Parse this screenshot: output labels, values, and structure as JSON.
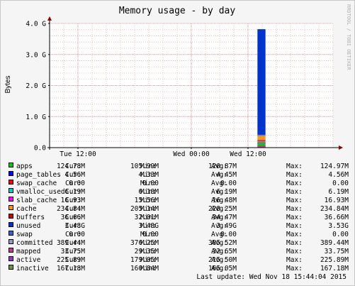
{
  "chart_data": {
    "type": "area",
    "title": "Memory usage - by day",
    "ylabel": "Bytes",
    "xlabel": "",
    "watermark": "RRDTOOL / TOBI OETIKER",
    "ylim": [
      0,
      4.0
    ],
    "y_unit": "G",
    "y_ticks": [
      "0.0",
      "1.0 G",
      "2.0 G",
      "3.0 G",
      "4.0 G"
    ],
    "y_tick_values": [
      0,
      1,
      2,
      3,
      4
    ],
    "x_ticks": [
      "Tue 12:00",
      "Wed 00:00",
      "Wed 12:00"
    ],
    "x_range_hours": [
      -30,
      30
    ],
    "x_tick_hours": [
      -24,
      0,
      12
    ],
    "data_start_hour": 14,
    "data_end_hour": 15.7,
    "grid": true,
    "series": [
      {
        "name": "apps",
        "color": "#00cc00",
        "gb": 0.122
      },
      {
        "name": "page_tables",
        "color": "#0000ff",
        "gb": 0.0045
      },
      {
        "name": "swap_cache",
        "color": "#ff0000",
        "gb": 0.0
      },
      {
        "name": "vmalloc_used",
        "color": "#00cccc",
        "gb": 0.006
      },
      {
        "name": "slab_cache",
        "color": "#ff00ff",
        "gb": 0.0165
      },
      {
        "name": "cache",
        "color": "#ff9900",
        "gb": 0.229
      },
      {
        "name": "buffers",
        "color": "#cc0000",
        "gb": 0.036
      },
      {
        "name": "unused",
        "color": "#0033cc",
        "gb": 3.4
      },
      {
        "name": "swap",
        "color": "#3366cc",
        "gb": 0.0
      },
      {
        "name": "committed",
        "color": "#9999cc",
        "gb": 0.38
      },
      {
        "name": "mapped",
        "color": "#cc3399",
        "gb": 0.033
      },
      {
        "name": "active",
        "color": "#9933cc",
        "gb": 0.221
      },
      {
        "name": "inactive",
        "color": "#669933",
        "gb": 0.163
      }
    ]
  },
  "legend": {
    "cur_label": "Cur:",
    "min_label": "Min:",
    "avg_label": "Avg:",
    "max_label": "Max:",
    "rows": [
      {
        "name": "apps",
        "color": "#00cc00",
        "cur": "124.78M",
        "min": "105.99M",
        "avg": "120.87M",
        "max": "124.97M"
      },
      {
        "name": "page_tables",
        "color": "#0000ff",
        "cur": "4.56M",
        "min": "4.33M",
        "avg": "4.45M",
        "max": "4.56M"
      },
      {
        "name": "swap_cache",
        "color": "#ff0000",
        "cur": "0.00",
        "min": "0.00",
        "avg": "0.00",
        "max": "0.00"
      },
      {
        "name": "vmalloc_used",
        "color": "#00cccc",
        "cur": "6.19M",
        "min": "6.18M",
        "avg": "6.19M",
        "max": "6.19M"
      },
      {
        "name": "slab_cache",
        "color": "#ff00ff",
        "cur": "16.93M",
        "min": "15.56M",
        "avg": "16.48M",
        "max": "16.93M"
      },
      {
        "name": "cache",
        "color": "#ff9900",
        "cur": "234.84M",
        "min": "205.14M",
        "avg": "228.25M",
        "max": "234.84M"
      },
      {
        "name": "buffers",
        "color": "#cc0000",
        "cur": "36.66M",
        "min": "32.01M",
        "avg": "34.47M",
        "max": "36.66M"
      },
      {
        "name": "unused",
        "color": "#0033cc",
        "cur": "3.48G",
        "min": "3.48G",
        "avg": "3.49G",
        "max": "3.53G"
      },
      {
        "name": "swap",
        "color": "#3366cc",
        "cur": "0.00",
        "min": "0.00",
        "avg": "0.00",
        "max": "0.00"
      },
      {
        "name": "committed",
        "color": "#9999cc",
        "cur": "389.44M",
        "min": "376.25M",
        "avg": "385.52M",
        "max": "389.44M"
      },
      {
        "name": "mapped",
        "color": "#cc3399",
        "cur": "33.75M",
        "min": "29.35M",
        "avg": "32.65M",
        "max": "33.75M"
      },
      {
        "name": "active",
        "color": "#9933cc",
        "cur": "225.89M",
        "min": "179.05M",
        "avg": "215.50M",
        "max": "225.89M"
      },
      {
        "name": "inactive",
        "color": "#669933",
        "cur": "167.18M",
        "min": "160.84M",
        "avg": "165.05M",
        "max": "167.18M"
      }
    ]
  },
  "last_update": "Last update: Wed Nov 18 15:44:04 2015"
}
